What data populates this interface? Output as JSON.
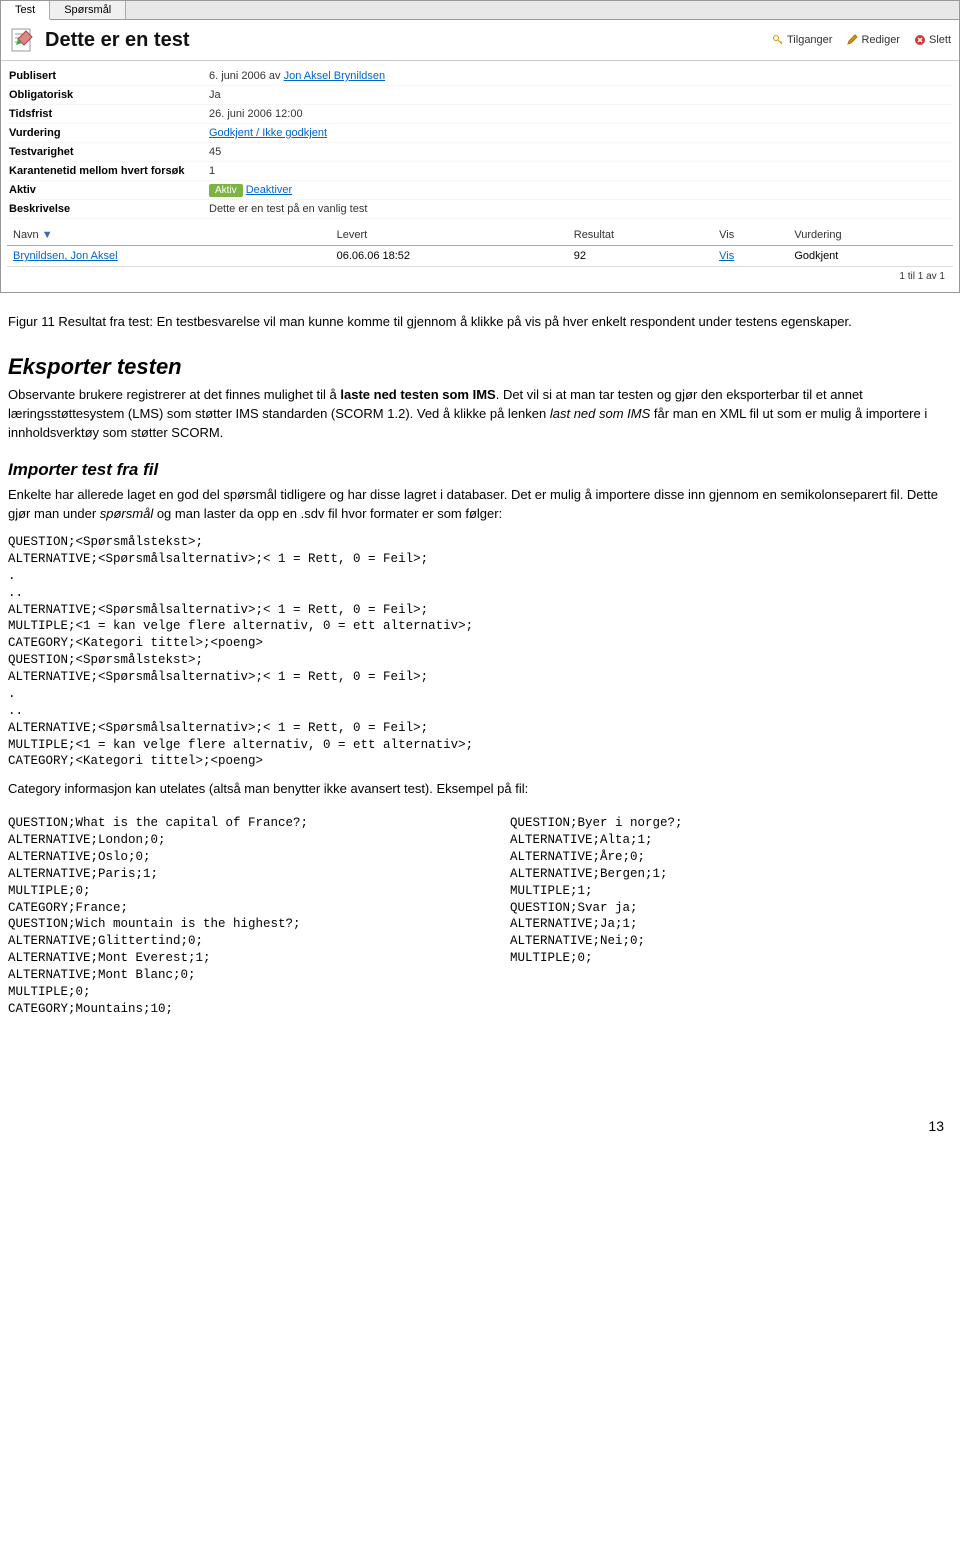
{
  "tabs": {
    "test": "Test",
    "sporsmal": "Spørsmål"
  },
  "header": {
    "title": "Dette er en test",
    "actions": {
      "tilganger": "Tilganger",
      "rediger": "Rediger",
      "slett": "Slett"
    }
  },
  "props": {
    "publisert_label": "Publisert",
    "publisert_value_prefix": "6. juni 2006 av ",
    "publisert_value_link": "Jon Aksel Brynildsen",
    "obligatorisk_label": "Obligatorisk",
    "obligatorisk_value": "Ja",
    "tidsfrist_label": "Tidsfrist",
    "tidsfrist_value": "26. juni 2006 12:00",
    "vurdering_label": "Vurdering",
    "vurdering_link": "Godkjent / Ikke godkjent",
    "testvarighet_label": "Testvarighet",
    "testvarighet_value": "45",
    "karantene_label": "Karantenetid mellom hvert forsøk",
    "karantene_value": "1",
    "aktiv_label": "Aktiv",
    "aktiv_badge": "Aktiv",
    "aktiv_link": "Deaktiver",
    "beskrivelse_label": "Beskrivelse",
    "beskrivelse_value": "Dette er en test på en vanlig test"
  },
  "table": {
    "headers": {
      "navn": "Navn",
      "levert": "Levert",
      "resultat": "Resultat",
      "vis": "Vis",
      "vurdering": "Vurdering"
    },
    "rows": [
      {
        "navn": "Brynildsen, Jon Aksel",
        "levert": "06.06.06 18:52",
        "resultat": "92",
        "vis": "Vis",
        "vurdering": "Godkjent"
      }
    ],
    "pagination": "1 til 1 av 1"
  },
  "doc": {
    "fig11": "Figur 11 Resultat fra test: En testbesvarelse vil man kunne komme til gjennom å klikke på vis på hver enkelt respondent under testens egenskaper.",
    "eksporter_h": "Eksporter testen",
    "eksporter_p1a": "Observante brukere registrerer at det finnes mulighet til å ",
    "eksporter_p1b": "laste ned testen som IMS",
    "eksporter_p1c": ". Det vil si at man tar testen og gjør den eksporterbar til et annet læringsstøttesystem (LMS) som støtter IMS standarden (SCORM 1.2). Ved å klikke på lenken ",
    "eksporter_p1d": "last ned som IMS",
    "eksporter_p1e": " får man en XML fil ut som er mulig å importere i innholdsverktøy som støtter SCORM.",
    "importer_h": "Importer test fra fil",
    "importer_p1a": "Enkelte har allerede laget en god del spørsmål tidligere og har disse lagret i databaser. Det er mulig å importere disse inn gjennom en semikolonseparert fil. Dette gjør man under ",
    "importer_p1b": "spørsmål",
    "importer_p1c": " og man laster da opp en .sdv fil hvor formater er som følger:",
    "format_block": "QUESTION;<Spørsmålstekst>;\nALTERNATIVE;<Spørsmålsalternativ>;< 1 = Rett, 0 = Feil>;\n.\n..\nALTERNATIVE;<Spørsmålsalternativ>;< 1 = Rett, 0 = Feil>;\nMULTIPLE;<1 = kan velge flere alternativ, 0 = ett alternativ>;\nCATEGORY;<Kategori tittel>;<poeng>\nQUESTION;<Spørsmålstekst>;\nALTERNATIVE;<Spørsmålsalternativ>;< 1 = Rett, 0 = Feil>;\n.\n..\nALTERNATIVE;<Spørsmålsalternativ>;< 1 = Rett, 0 = Feil>;\nMULTIPLE;<1 = kan velge flere alternativ, 0 = ett alternativ>;\nCATEGORY;<Kategori tittel>;<poeng>",
    "category_note": "Category informasjon kan utelates (altså man benytter ikke avansert test). Eksempel på fil:",
    "example_left": "QUESTION;What is the capital of France?;\nALTERNATIVE;London;0;\nALTERNATIVE;Oslo;0;\nALTERNATIVE;Paris;1;\nMULTIPLE;0;\nCATEGORY;France;\nQUESTION;Wich mountain is the highest?;\nALTERNATIVE;Glittertind;0;\nALTERNATIVE;Mont Everest;1;\nALTERNATIVE;Mont Blanc;0;\nMULTIPLE;0;\nCATEGORY;Mountains;10;",
    "example_right": "QUESTION;Byer i norge?;\nALTERNATIVE;Alta;1;\nALTERNATIVE;Åre;0;\nALTERNATIVE;Bergen;1;\nMULTIPLE;1;\nQUESTION;Svar ja;\nALTERNATIVE;Ja;1;\nALTERNATIVE;Nei;0;\nMULTIPLE;0;",
    "page_num": "13"
  }
}
